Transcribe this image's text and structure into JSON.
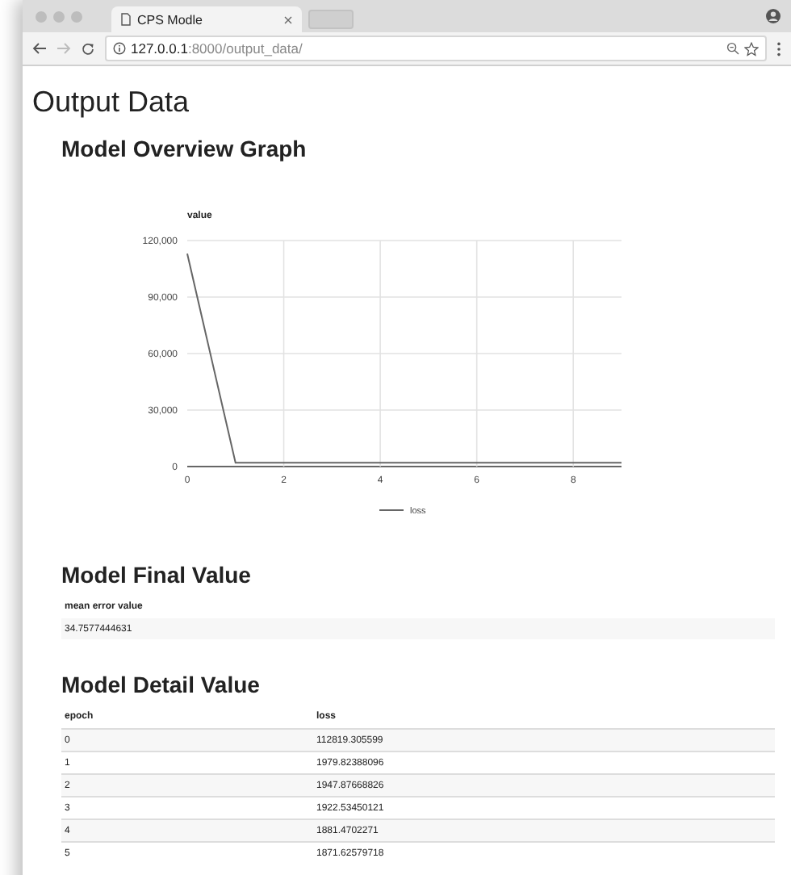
{
  "browser": {
    "tab_title": "CPS Modle",
    "url_host": "127.0.0.1",
    "url_rest": ":8000/output_data/"
  },
  "page_title": "Output Data",
  "overview": {
    "heading": "Model Overview Graph",
    "chart_data": {
      "type": "line",
      "ylabel": "value",
      "x": [
        0,
        1,
        2,
        3,
        4,
        5,
        6,
        7,
        8,
        9
      ],
      "series": [
        {
          "name": "loss",
          "color": "#666666",
          "values": [
            113000,
            2000,
            2000,
            2000,
            2000,
            2000,
            2000,
            2000,
            2000,
            2000
          ]
        }
      ],
      "grid": true,
      "xlim": [
        0,
        9
      ],
      "ylim": [
        0,
        120000
      ],
      "xticks": [
        0,
        2,
        4,
        6,
        8
      ],
      "yticks": [
        {
          "value": 0,
          "label": "0"
        },
        {
          "value": 30000,
          "label": "30,000"
        },
        {
          "value": 60000,
          "label": "60,000"
        },
        {
          "value": 90000,
          "label": "90,000"
        },
        {
          "value": 120000,
          "label": "120,000"
        }
      ]
    }
  },
  "final": {
    "heading": "Model Final Value",
    "columns": [
      "mean error value"
    ],
    "rows": [
      [
        "34.7577444631"
      ]
    ]
  },
  "detail": {
    "heading": "Model Detail Value",
    "columns": [
      "epoch",
      "loss"
    ],
    "rows": [
      [
        "0",
        "112819.305599"
      ],
      [
        "1",
        "1979.82388096"
      ],
      [
        "2",
        "1947.87668826"
      ],
      [
        "3",
        "1922.53450121"
      ],
      [
        "4",
        "1881.4702271"
      ],
      [
        "5",
        "1871.62579718"
      ]
    ]
  }
}
